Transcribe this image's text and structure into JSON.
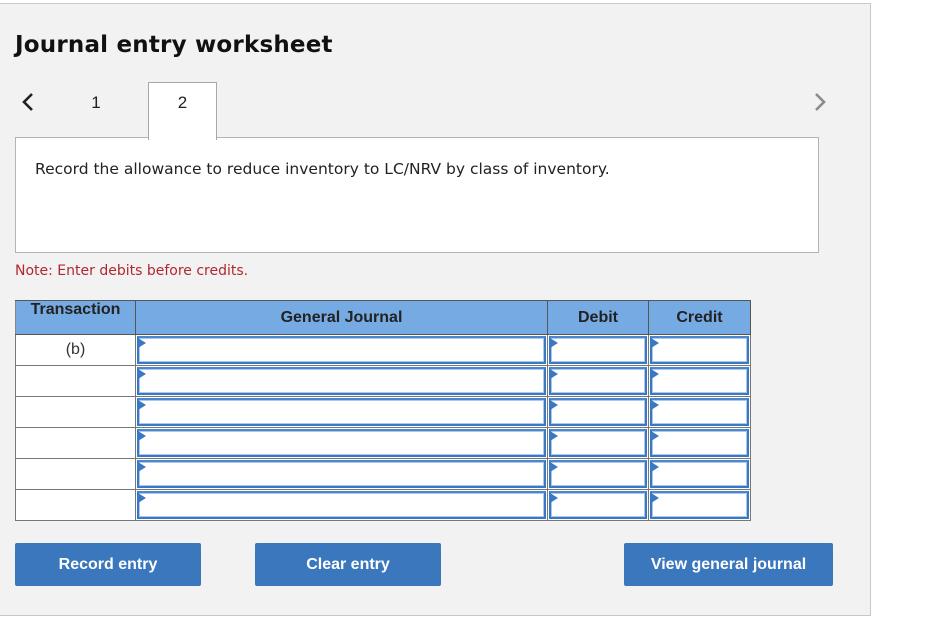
{
  "worksheet": {
    "title": "Journal entry worksheet",
    "nav": {
      "prev_icon": "chevron-left-icon",
      "next_icon": "chevron-right-icon"
    },
    "tabs": [
      {
        "label": "1",
        "active": false
      },
      {
        "label": "2",
        "active": true
      }
    ],
    "instruction": "Record the allowance to reduce inventory to LC/NRV by class of inventory.",
    "note": "Note: Enter debits before credits."
  },
  "table": {
    "headers": [
      "Transaction",
      "General Journal",
      "Debit",
      "Credit"
    ],
    "rows": [
      {
        "transaction": "(b)",
        "account": "",
        "debit": "",
        "credit": ""
      },
      {
        "transaction": "",
        "account": "",
        "debit": "",
        "credit": ""
      },
      {
        "transaction": "",
        "account": "",
        "debit": "",
        "credit": ""
      },
      {
        "transaction": "",
        "account": "",
        "debit": "",
        "credit": ""
      },
      {
        "transaction": "",
        "account": "",
        "debit": "",
        "credit": ""
      },
      {
        "transaction": "",
        "account": "",
        "debit": "",
        "credit": ""
      }
    ]
  },
  "buttons": {
    "record": "Record entry",
    "clear": "Clear entry",
    "view": "View general journal"
  },
  "colors": {
    "header_bg": "#76aae2",
    "button_bg": "#3b77bc",
    "note_text": "#b0272d",
    "input_border": "#3a78c3",
    "panel_bg": "#f2f2f2"
  }
}
